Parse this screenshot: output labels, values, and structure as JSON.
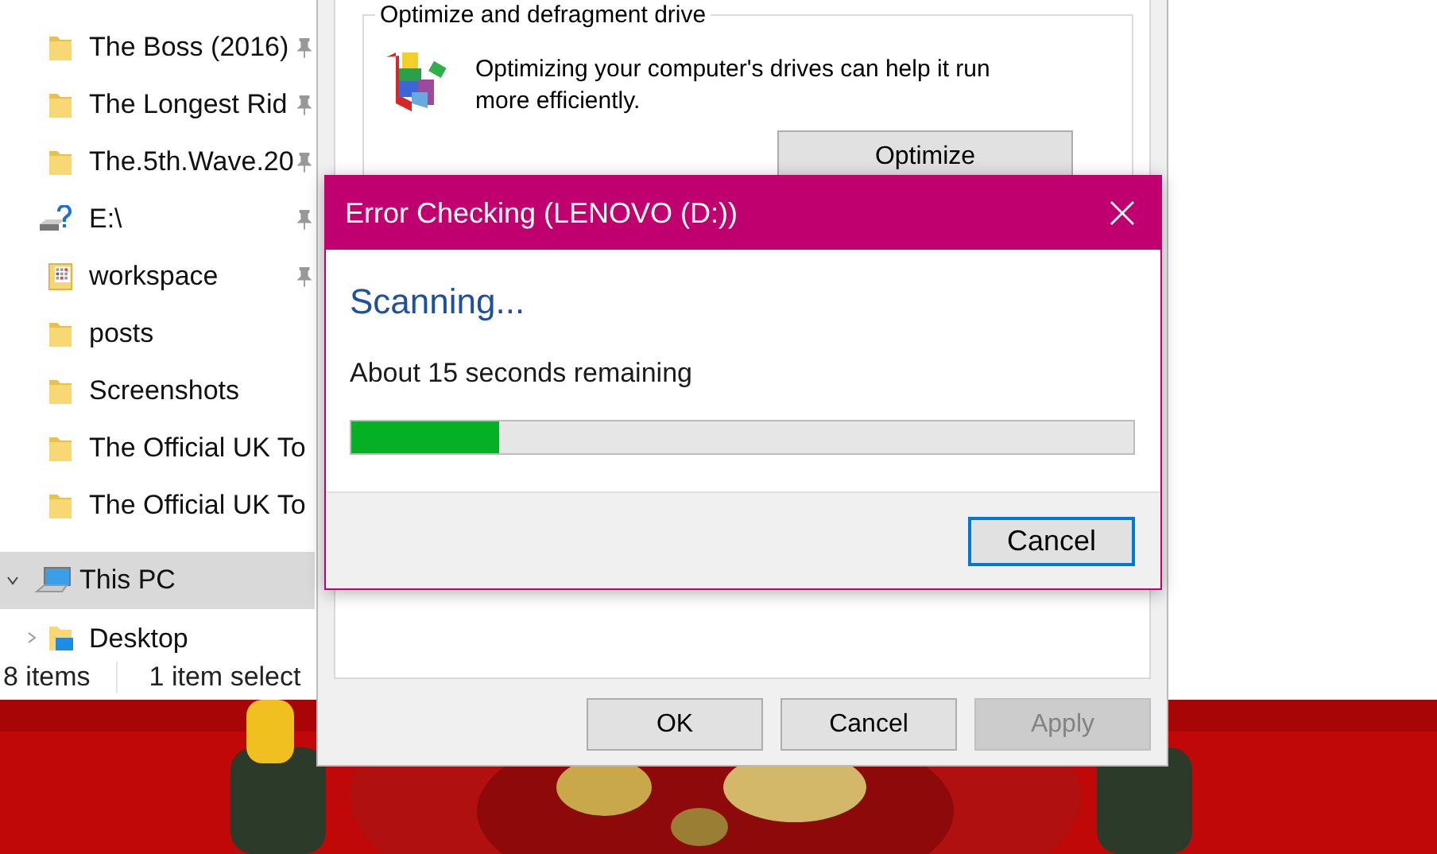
{
  "explorer": {
    "quick_access": [
      {
        "label": "The Boss (2016)",
        "kind": "folder",
        "pinned": true
      },
      {
        "label": "The Longest Rid",
        "kind": "folder",
        "pinned": true
      },
      {
        "label": "The.5th.Wave.20",
        "kind": "folder",
        "pinned": true
      },
      {
        "label": "E:\\",
        "kind": "drive",
        "pinned": true
      },
      {
        "label": "workspace",
        "kind": "library",
        "pinned": true
      },
      {
        "label": "posts",
        "kind": "folder",
        "pinned": false
      },
      {
        "label": "Screenshots",
        "kind": "folder",
        "pinned": false
      },
      {
        "label": "The Official UK To",
        "kind": "folder",
        "pinned": false
      },
      {
        "label": "The Official UK To",
        "kind": "folder",
        "pinned": false
      }
    ],
    "this_pc": {
      "label": "This PC",
      "selected": true,
      "expanded": true,
      "children": [
        {
          "label": "Desktop",
          "expanded": false
        }
      ]
    },
    "status_bar": {
      "item_count": "8 items",
      "selection": "1 item select"
    }
  },
  "properties": {
    "group_title": "Optimize and defragment drive",
    "description": "Optimizing your computer's drives can help it run more efficiently.",
    "optimize_button": "Optimize",
    "buttons": [
      {
        "label": "OK",
        "disabled": false
      },
      {
        "label": "Cancel",
        "disabled": false
      },
      {
        "label": "Apply",
        "disabled": true
      }
    ]
  },
  "error_checking": {
    "title": "Error Checking (LENOVO (D:))",
    "heading": "Scanning...",
    "status": "About 15 seconds remaining",
    "level": 0.19,
    "cancel_button": "Cancel"
  }
}
